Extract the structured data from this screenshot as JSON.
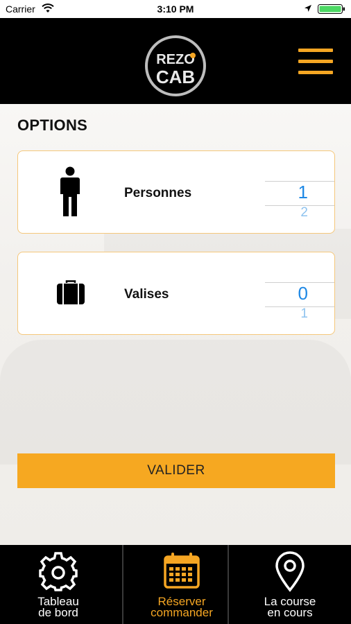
{
  "status_bar": {
    "carrier": "Carrier",
    "time": "3:10 PM",
    "icons": [
      "wifi-icon",
      "location-arrow-icon",
      "battery-icon"
    ]
  },
  "header": {
    "logo_top": "REZO",
    "logo_bottom": "CAB",
    "menu_icon": "hamburger-menu-icon"
  },
  "colors": {
    "accent": "#f5a623",
    "header_bg": "#000000",
    "picker_blue": "#1e88e5"
  },
  "options": {
    "title": "OPTIONS",
    "persons": {
      "label": "Personnes",
      "value": "1",
      "next_value": "2",
      "icon": "person-icon"
    },
    "bags": {
      "label": "Valises",
      "value": "0",
      "next_value": "1",
      "icon": "suitcase-icon"
    }
  },
  "valider_label": "VALIDER",
  "tabs": [
    {
      "label": "Tableau\nde bord",
      "icon": "gear-icon",
      "active": false
    },
    {
      "label": "Réserver\ncommander",
      "icon": "calendar-icon",
      "active": true
    },
    {
      "label": "La course\nen cours",
      "icon": "map-pin-icon",
      "active": false
    }
  ]
}
